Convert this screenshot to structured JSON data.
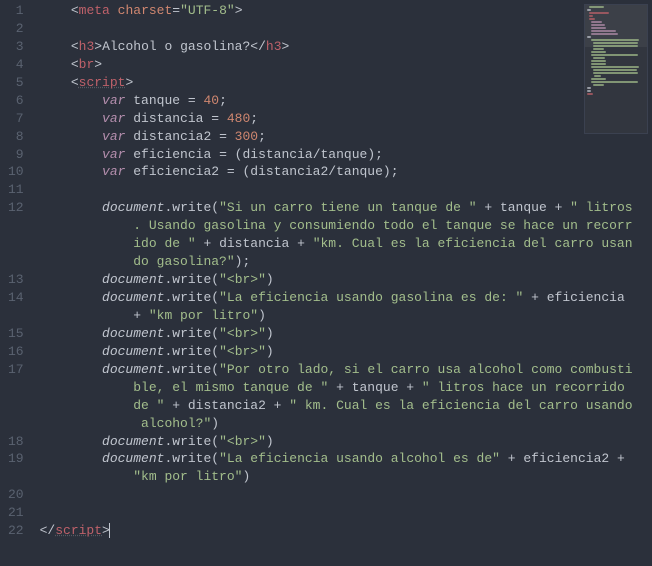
{
  "editor": {
    "line_count": 22,
    "cursor_line": 22,
    "lines": [
      [
        [
          "punc",
          "    <"
        ],
        [
          "tag",
          "meta"
        ],
        [
          "punc",
          " "
        ],
        [
          "attr",
          "charset"
        ],
        [
          "punc",
          "="
        ],
        [
          "str",
          "\"UTF-8\""
        ],
        [
          "punc",
          ">"
        ]
      ],
      [
        [
          "punc",
          ""
        ]
      ],
      [
        [
          "punc",
          "    <"
        ],
        [
          "tag",
          "h3"
        ],
        [
          "punc",
          ">"
        ],
        [
          "var",
          "Alcohol o gasolina?"
        ],
        [
          "punc",
          "</"
        ],
        [
          "tag",
          "h3"
        ],
        [
          "punc",
          ">"
        ]
      ],
      [
        [
          "punc",
          "    <"
        ],
        [
          "tag",
          "br"
        ],
        [
          "punc",
          ">"
        ]
      ],
      [
        [
          "punc",
          "    <"
        ],
        [
          "tagline",
          "script"
        ],
        [
          "punc",
          ">"
        ]
      ],
      [
        [
          "punc",
          "        "
        ],
        [
          "kw-i",
          "var"
        ],
        [
          "var",
          " tanque "
        ],
        [
          "punc",
          "= "
        ],
        [
          "num",
          "40"
        ],
        [
          "punc",
          ";"
        ]
      ],
      [
        [
          "punc",
          "        "
        ],
        [
          "kw-i",
          "var"
        ],
        [
          "var",
          " distancia "
        ],
        [
          "punc",
          "= "
        ],
        [
          "num",
          "480"
        ],
        [
          "punc",
          ";"
        ]
      ],
      [
        [
          "punc",
          "        "
        ],
        [
          "kw-i",
          "var"
        ],
        [
          "var",
          " distancia2 "
        ],
        [
          "punc",
          "= "
        ],
        [
          "num",
          "300"
        ],
        [
          "punc",
          ";"
        ]
      ],
      [
        [
          "punc",
          "        "
        ],
        [
          "kw-i",
          "var"
        ],
        [
          "var",
          " eficiencia "
        ],
        [
          "punc",
          "= ("
        ],
        [
          "var",
          "distancia"
        ],
        [
          "punc",
          "/"
        ],
        [
          "var",
          "tanque"
        ],
        [
          "punc",
          ");"
        ]
      ],
      [
        [
          "punc",
          "        "
        ],
        [
          "kw-i",
          "var"
        ],
        [
          "var",
          " eficiencia2 "
        ],
        [
          "punc",
          "= ("
        ],
        [
          "var",
          "distancia2"
        ],
        [
          "punc",
          "/"
        ],
        [
          "var",
          "tanque"
        ],
        [
          "punc",
          ");"
        ]
      ],
      [
        [
          "punc",
          ""
        ]
      ],
      [
        [
          "punc",
          "        "
        ],
        [
          "ital",
          "document"
        ],
        [
          "punc",
          "."
        ],
        [
          "var",
          "write"
        ],
        [
          "punc",
          "("
        ],
        [
          "str",
          "\"Si un carro tiene un tanque de \""
        ],
        [
          "punc",
          " + "
        ],
        [
          "var",
          "tanque"
        ],
        [
          "punc",
          " + "
        ],
        [
          "str",
          "\" litros. Usando gasolina y consumiendo todo el tanque se hace un recorrido de \""
        ],
        [
          "punc",
          " + "
        ],
        [
          "var",
          "distancia"
        ],
        [
          "punc",
          " + "
        ],
        [
          "str",
          "\"km. Cual es la eficiencia del carro usando gasolina?\""
        ],
        [
          "punc",
          ");"
        ]
      ],
      [
        [
          "punc",
          "        "
        ],
        [
          "ital",
          "document"
        ],
        [
          "punc",
          "."
        ],
        [
          "var",
          "write"
        ],
        [
          "punc",
          "("
        ],
        [
          "str",
          "\"<br>\""
        ],
        [
          "punc",
          ")"
        ]
      ],
      [
        [
          "punc",
          "        "
        ],
        [
          "ital",
          "document"
        ],
        [
          "punc",
          "."
        ],
        [
          "var",
          "write"
        ],
        [
          "punc",
          "("
        ],
        [
          "str",
          "\"La eficiencia usando gasolina es de: \""
        ],
        [
          "punc",
          " + "
        ],
        [
          "var",
          "eficiencia"
        ],
        [
          "punc",
          " + "
        ],
        [
          "str",
          "\"km por litro\""
        ],
        [
          "punc",
          ")"
        ]
      ],
      [
        [
          "punc",
          "        "
        ],
        [
          "ital",
          "document"
        ],
        [
          "punc",
          "."
        ],
        [
          "var",
          "write"
        ],
        [
          "punc",
          "("
        ],
        [
          "str",
          "\"<br>\""
        ],
        [
          "punc",
          ")"
        ]
      ],
      [
        [
          "punc",
          "        "
        ],
        [
          "ital",
          "document"
        ],
        [
          "punc",
          "."
        ],
        [
          "var",
          "write"
        ],
        [
          "punc",
          "("
        ],
        [
          "str",
          "\"<br>\""
        ],
        [
          "punc",
          ")"
        ]
      ],
      [
        [
          "punc",
          "        "
        ],
        [
          "ital",
          "document"
        ],
        [
          "punc",
          "."
        ],
        [
          "var",
          "write"
        ],
        [
          "punc",
          "("
        ],
        [
          "str",
          "\"Por otro lado, si el carro usa alcohol como combustible, el mismo tanque de \""
        ],
        [
          "punc",
          " + "
        ],
        [
          "var",
          "tanque"
        ],
        [
          "punc",
          " + "
        ],
        [
          "str",
          "\" litros hace un recorrido de \""
        ],
        [
          "punc",
          " + "
        ],
        [
          "var",
          "distancia2"
        ],
        [
          "punc",
          " + "
        ],
        [
          "str",
          "\" km. Cual es la eficiencia del carro usando alcohol?\""
        ],
        [
          "punc",
          ")"
        ]
      ],
      [
        [
          "punc",
          "        "
        ],
        [
          "ital",
          "document"
        ],
        [
          "punc",
          "."
        ],
        [
          "var",
          "write"
        ],
        [
          "punc",
          "("
        ],
        [
          "str",
          "\"<br>\""
        ],
        [
          "punc",
          ")"
        ]
      ],
      [
        [
          "punc",
          "        "
        ],
        [
          "ital",
          "document"
        ],
        [
          "punc",
          "."
        ],
        [
          "var",
          "write"
        ],
        [
          "punc",
          "("
        ],
        [
          "str",
          "\"La eficiencia usando alcohol es de\""
        ],
        [
          "punc",
          " + "
        ],
        [
          "var",
          "eficiencia2"
        ],
        [
          "punc",
          " + "
        ],
        [
          "str",
          "\"km por litro\""
        ],
        [
          "punc",
          ")"
        ]
      ],
      [
        [
          "punc",
          ""
        ]
      ],
      [
        [
          "punc",
          ""
        ]
      ],
      [
        [
          "punc",
          "</"
        ],
        [
          "tagline",
          "script"
        ],
        [
          "punc",
          ">"
        ]
      ]
    ]
  },
  "minimap": {
    "colors": {
      "punc": "#6b7280",
      "tag": "#bf616a",
      "str": "#a3be8c",
      "var": "#c0c5ce",
      "kw": "#b48ead",
      "num": "#d08770"
    }
  }
}
